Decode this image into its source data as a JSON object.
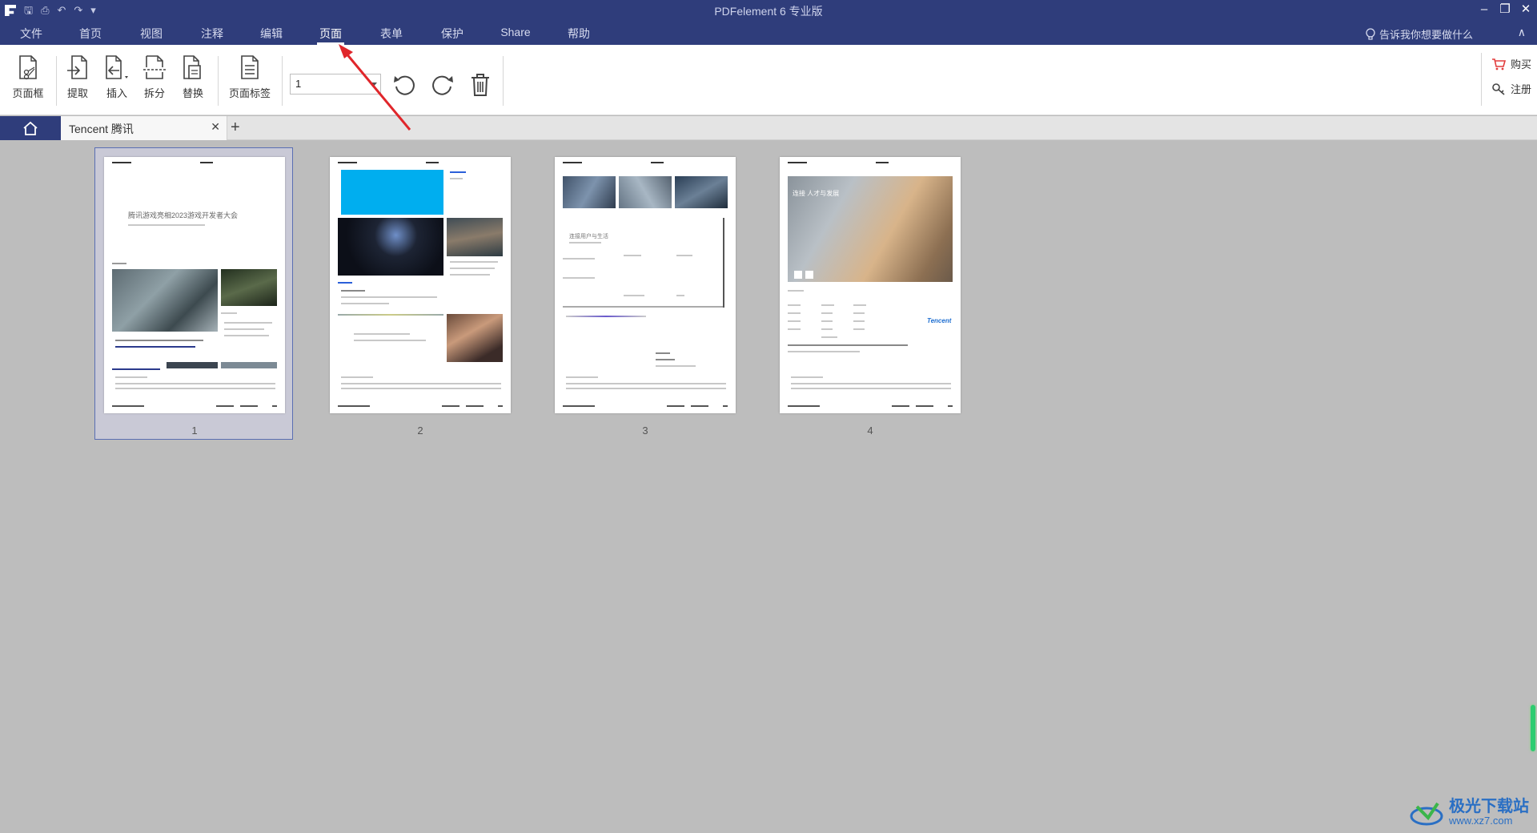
{
  "window": {
    "title": "PDFelement  6 专业版",
    "controls": [
      "–",
      "❐",
      "✕"
    ]
  },
  "menu": {
    "items": [
      "文件",
      "首页",
      "视图",
      "注释",
      "编辑",
      "页面",
      "表单",
      "保护",
      "Share",
      "帮助"
    ],
    "active": "页面",
    "tell_me": "告诉我你想要做什么"
  },
  "ribbon": {
    "page_box": "页面框",
    "extract": "提取",
    "insert": "插入",
    "split": "拆分",
    "replace": "替换",
    "page_label": "页面标签",
    "page_select_value": "1",
    "buy": "购买",
    "register": "注册"
  },
  "tabs": {
    "doc_tab": "Tencent 腾讯"
  },
  "pages": [
    {
      "number": "1",
      "title": "腾讯游戏亮相2023游戏开发者大会",
      "selected": true
    },
    {
      "number": "2",
      "title": "",
      "selected": false
    },
    {
      "number": "3",
      "title": "连接用户与生活",
      "selected": false
    },
    {
      "number": "4",
      "title": "连接 人才与发展",
      "logo": "Tencent",
      "selected": false
    }
  ],
  "watermark": {
    "name": "极光下载站",
    "url": "www.xz7.com"
  },
  "colors": {
    "titlebar": "#2f3d7b",
    "accent_blue": "#00aeef",
    "annotation": "#e0262b"
  }
}
